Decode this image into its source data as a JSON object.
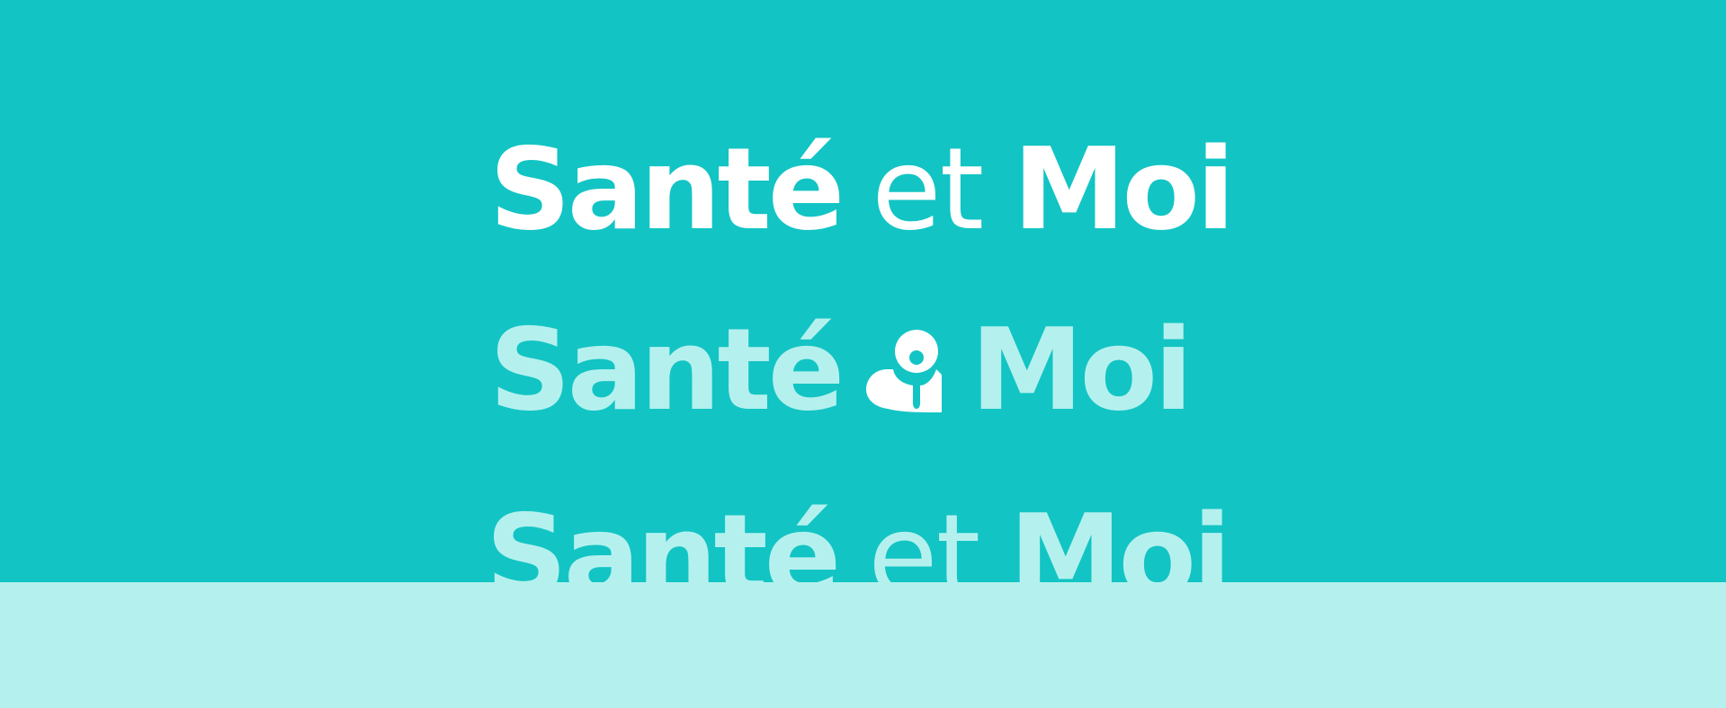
{
  "colors": {
    "background_primary": "#13c4c4",
    "background_secondary": "#b4f1ee",
    "text_white": "#ffffff",
    "text_pale": "#b4f1ee"
  },
  "logo_white": {
    "word1": "Santé",
    "word2": "et",
    "word3": "Moi"
  },
  "logo_emblem": {
    "word1": "Santé",
    "emblem_icon": "person-heart-emblem-icon",
    "word3": "Moi"
  },
  "logo_cut": {
    "word1": "Santé",
    "word2": "et",
    "word3": "Moi"
  }
}
